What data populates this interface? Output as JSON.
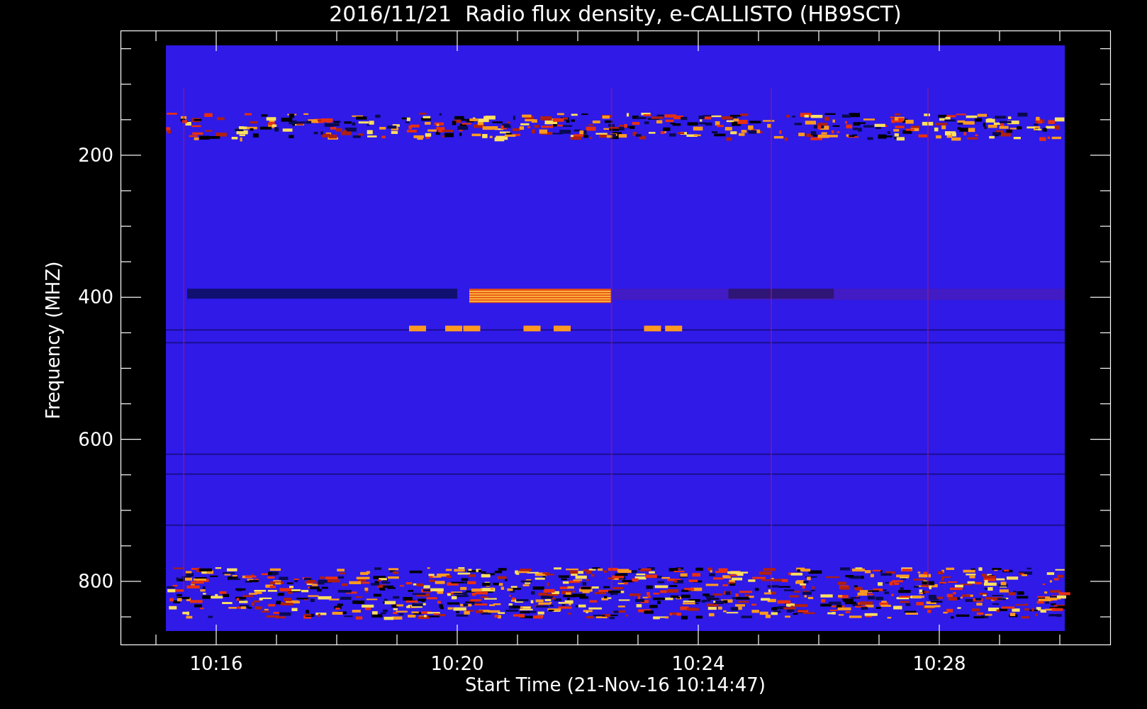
{
  "title": "2016/11/21  Radio flux density, e-CALLISTO (HB9SCT)",
  "xlabel": "Start Time (21-Nov-16 10:14:47)",
  "ylabel": "Frequency (MHZ)",
  "xtick_labels": [
    "10:16",
    "10:20",
    "10:24",
    "10:28"
  ],
  "ytick_labels": [
    "200",
    "400",
    "600",
    "800"
  ]
}
